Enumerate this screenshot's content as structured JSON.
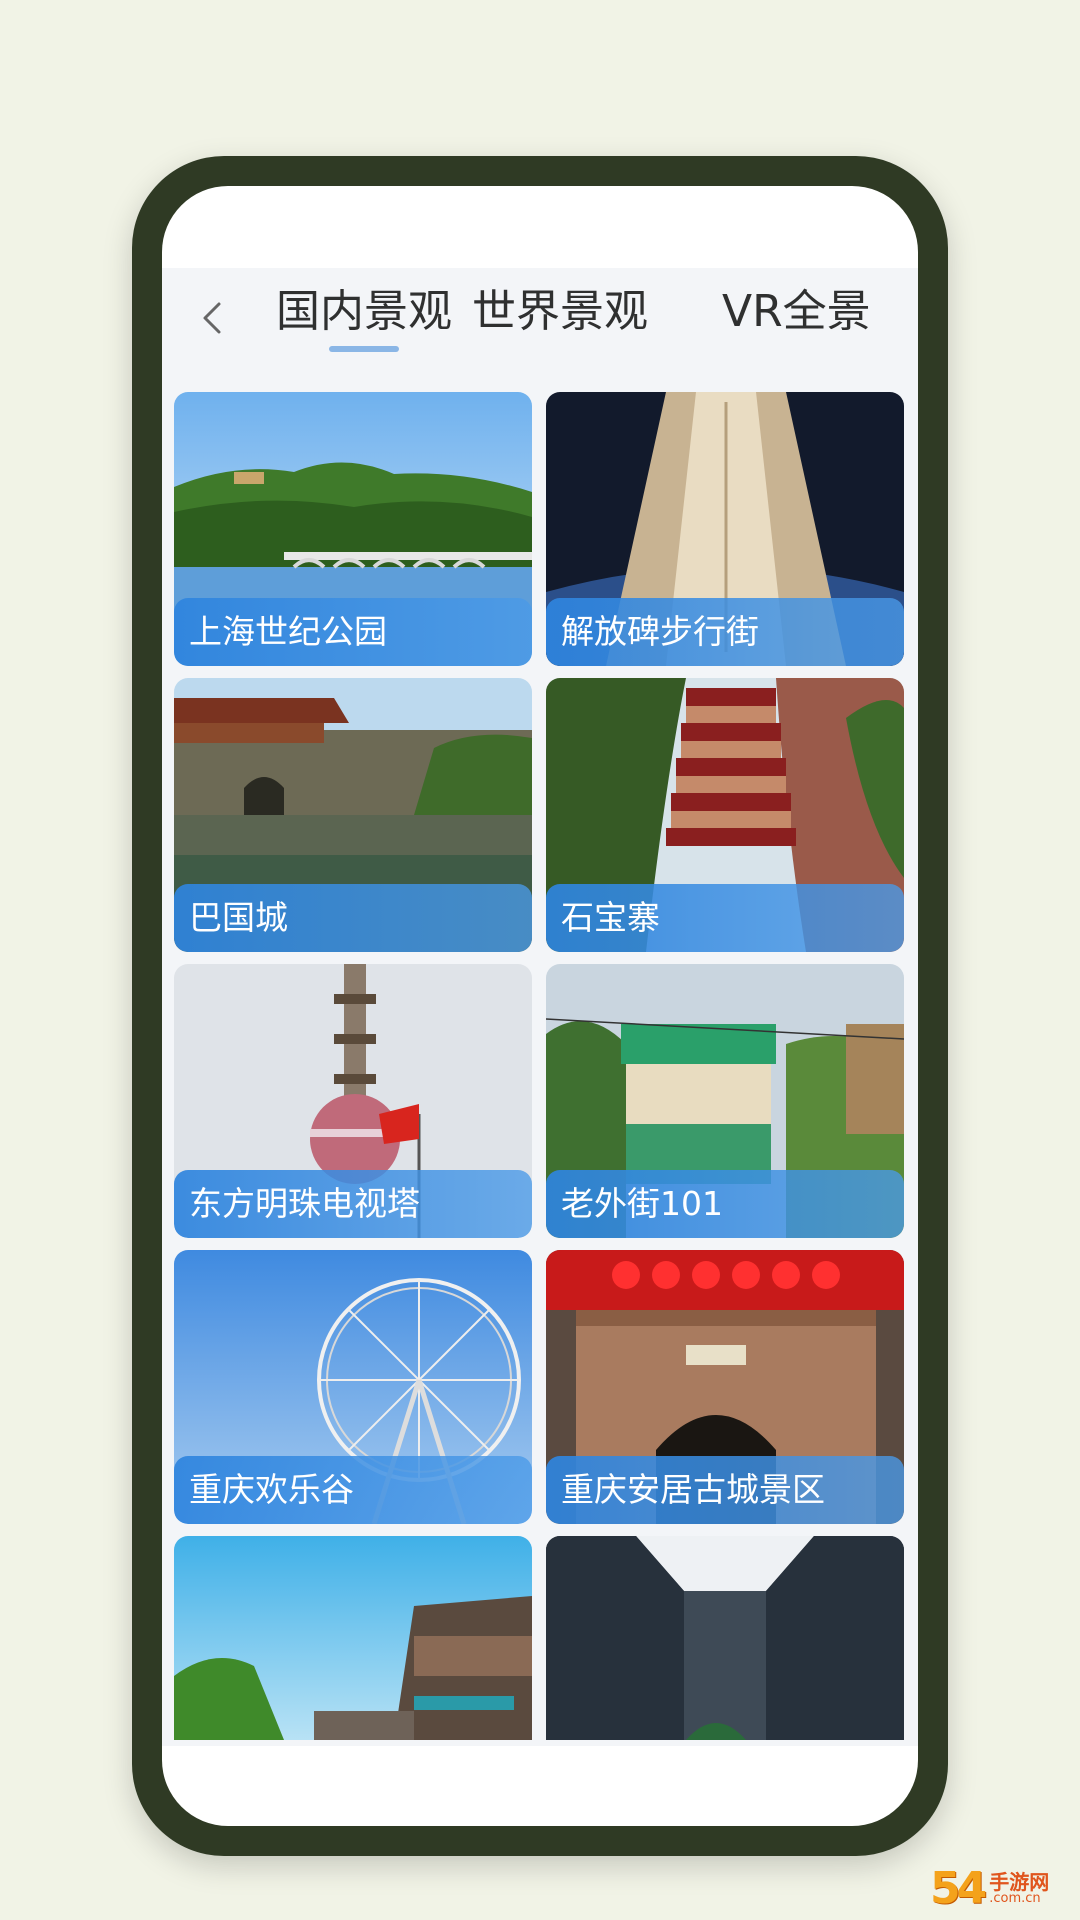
{
  "header": {
    "tabs": [
      {
        "label": "国内景观",
        "active": true
      },
      {
        "label": "世界景观",
        "active": false
      },
      {
        "label": "VR全景",
        "active": false
      }
    ]
  },
  "cards": [
    {
      "title": "上海世纪公园",
      "icon": "park-bridge-photo"
    },
    {
      "title": "解放碑步行街",
      "icon": "monument-photo"
    },
    {
      "title": "巴国城",
      "icon": "city-gate-photo"
    },
    {
      "title": "石宝寨",
      "icon": "pagoda-cliff-photo"
    },
    {
      "title": "东方明珠电视塔",
      "icon": "tv-tower-photo"
    },
    {
      "title": "老外街101",
      "icon": "street-building-photo"
    },
    {
      "title": "重庆欢乐谷",
      "icon": "ferris-wheel-photo"
    },
    {
      "title": "重庆安居古城景区",
      "icon": "ancient-gate-photo"
    },
    {
      "title": "",
      "icon": "water-town-photo"
    },
    {
      "title": "",
      "icon": "courtyard-photo"
    }
  ],
  "watermark": {
    "num": "54",
    "cn": "手游网",
    "domain": ".com.cn"
  },
  "colors": {
    "accent": "#8ab6e6",
    "label_bg": "#2e84de",
    "phone_frame": "#2f3a24"
  }
}
